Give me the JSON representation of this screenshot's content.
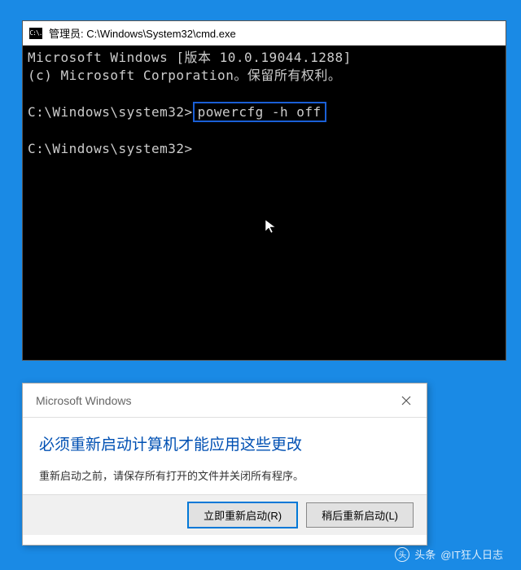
{
  "cmd": {
    "icon_text": "C:\\.",
    "title": "管理员: C:\\Windows\\System32\\cmd.exe",
    "line1": "Microsoft Windows [版本 10.0.19044.1288]",
    "line2": "(c) Microsoft Corporation。保留所有权利。",
    "prompt1_prefix": "C:\\Windows\\system32>",
    "command": "powercfg -h off",
    "prompt2": "C:\\Windows\\system32>"
  },
  "dialog": {
    "title": "Microsoft Windows",
    "heading": "必须重新启动计算机才能应用这些更改",
    "body": "重新启动之前，请保存所有打开的文件并关闭所有程序。",
    "btn_restart": "立即重新启动(R)",
    "btn_later": "稍后重新启动(L)"
  },
  "watermark": {
    "label": "头条",
    "handle": "@IT狂人日志"
  }
}
